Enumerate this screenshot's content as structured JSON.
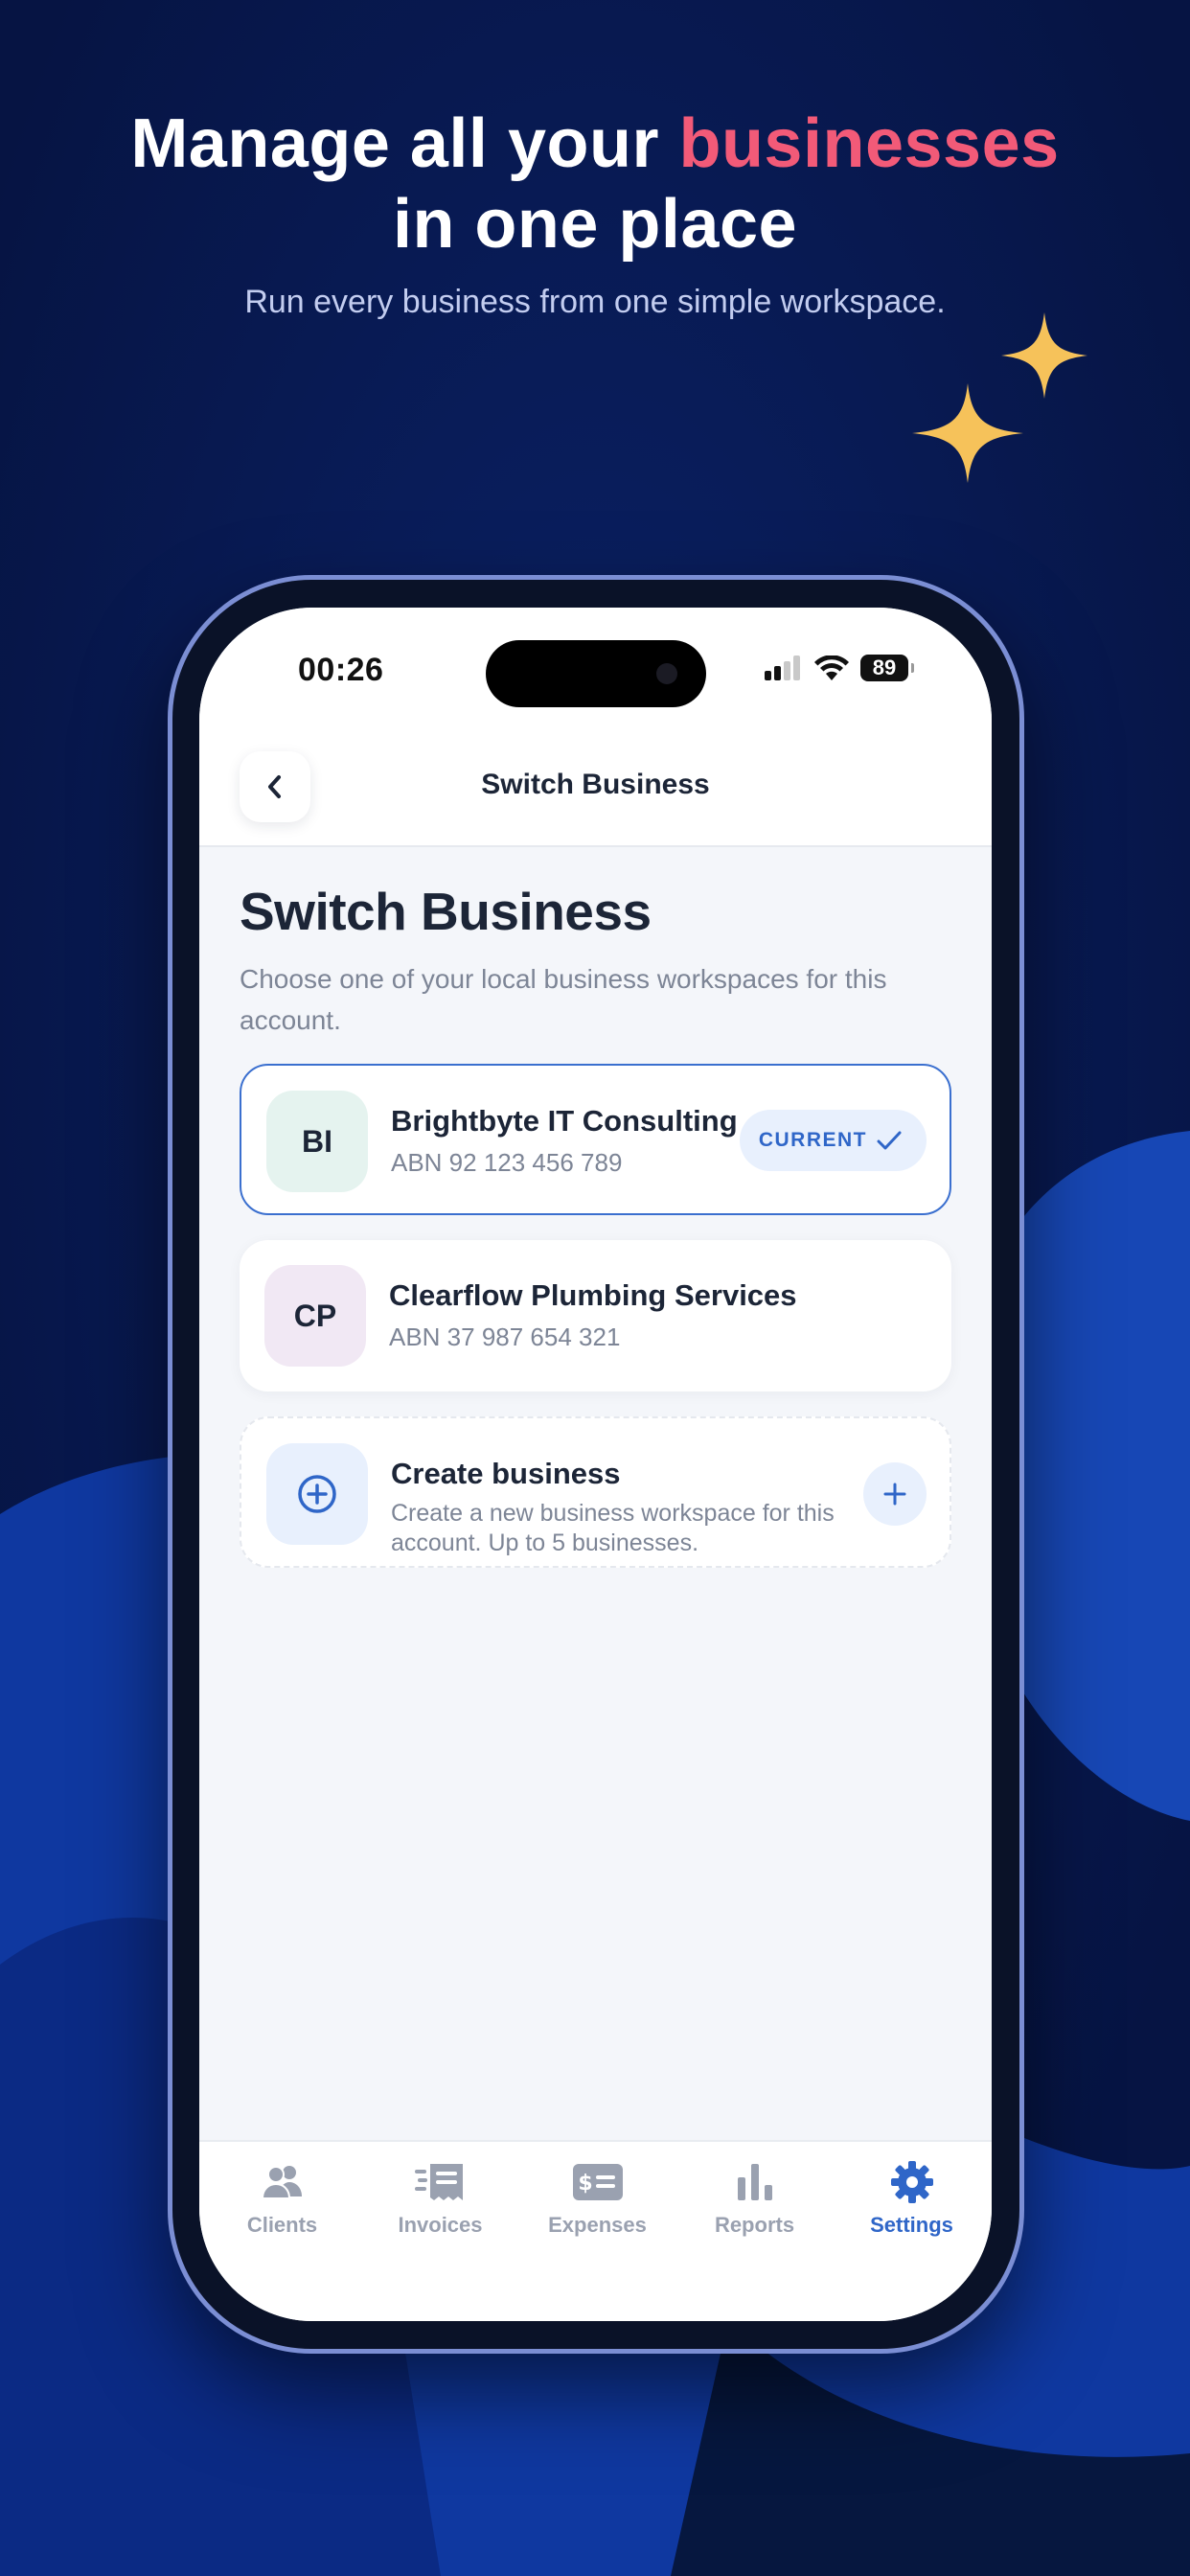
{
  "promo": {
    "title_start": "Manage all your ",
    "title_accent": "businesses",
    "title_end": "in one place",
    "subtitle": "Run every business from one simple workspace."
  },
  "status_bar": {
    "time": "00:26",
    "battery": "89"
  },
  "nav": {
    "title": "Switch Business"
  },
  "page": {
    "title": "Switch Business",
    "description": "Choose one of your local business workspaces for this account."
  },
  "businesses": [
    {
      "initials": "BI",
      "name": "Brightbyte IT Consulting",
      "abn": "ABN 92 123 456 789",
      "badge": "CURRENT"
    },
    {
      "initials": "CP",
      "name": "Clearflow Plumbing Services",
      "abn": "ABN 37 987 654 321"
    }
  ],
  "create": {
    "title": "Create business",
    "description": "Create a new business workspace for this account. Up to 5 businesses."
  },
  "tabs": [
    {
      "label": "Clients",
      "icon": "users-icon"
    },
    {
      "label": "Invoices",
      "icon": "invoice-icon"
    },
    {
      "label": "Expenses",
      "icon": "expense-icon"
    },
    {
      "label": "Reports",
      "icon": "bar-chart-icon"
    },
    {
      "label": "Settings",
      "icon": "gear-icon",
      "active": true
    }
  ],
  "colors": {
    "background": "#08184f",
    "accent_pink": "#f25a78",
    "primary_blue": "#2f66c8",
    "sparkle": "#f6c25a"
  }
}
